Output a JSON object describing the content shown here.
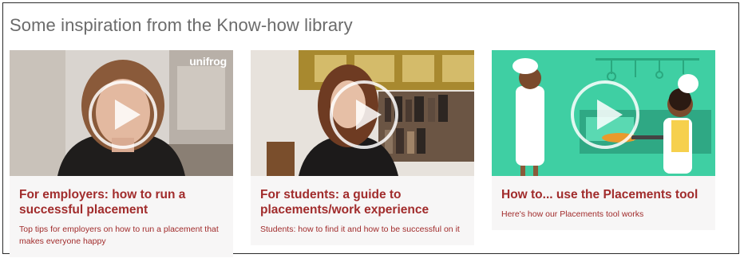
{
  "section": {
    "title": "Some inspiration from the Know-how library"
  },
  "cards": [
    {
      "title": "For employers: how to run a successful placement",
      "description": "Top tips for employers on how to run a placement that makes everyone happy",
      "brand_watermark": "unifrog",
      "thumbnail_icon": "video-thumbnail",
      "play_icon": "play-circle-icon"
    },
    {
      "title": "For students: a guide to placements/work experience",
      "description": "Students: how to find it and how to be successful on it",
      "thumbnail_icon": "video-thumbnail",
      "play_icon": "play-circle-icon"
    },
    {
      "title": "How to... use the Placements tool",
      "description": "Here's how our Placements tool works",
      "thumbnail_icon": "video-thumbnail",
      "play_icon": "play-circle-icon"
    }
  ],
  "colors": {
    "title_text": "#6b6b6b",
    "card_text": "#a12c2c",
    "card_bg": "#f7f6f6",
    "illustration_bg": "#3fcfa3"
  }
}
